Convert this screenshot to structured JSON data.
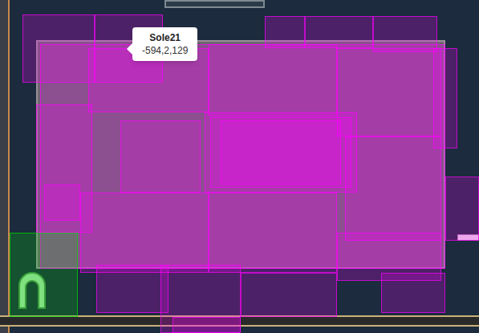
{
  "tooltip": {
    "title": "Sole21",
    "coords": "-594,2,129"
  },
  "regions": [
    {
      "color": "#ff00ff"
    },
    {
      "color": "#ff00ff"
    },
    {
      "color": "#ff00ff"
    },
    {
      "color": "#ff00ff"
    },
    {
      "color": "#ff00ff"
    },
    {
      "color": "#ff00ff"
    },
    {
      "color": "#ff00ff"
    },
    {
      "color": "#ff00ff"
    },
    {
      "color": "#ff00ff"
    },
    {
      "color": "#ff00ff"
    },
    {
      "color": "#ff00ff"
    },
    {
      "color": "#ff00ff"
    },
    {
      "color": "#ff00ff"
    },
    {
      "color": "#ff00ff"
    },
    {
      "color": "#ff00ff"
    },
    {
      "color": "#ff00ff"
    },
    {
      "color": "#ff00ff"
    },
    {
      "color": "#ff00ff"
    },
    {
      "color": "#ff00ff"
    },
    {
      "color": "#ff00ff"
    },
    {
      "color": "#ff00ff"
    },
    {
      "color": "#ff00ff"
    },
    {
      "color": "#ff00ff"
    },
    {
      "color": "#ff00ff"
    },
    {
      "color": "#ff00ff"
    },
    {
      "color": "#ff00ff"
    },
    {
      "color": "#00e000"
    }
  ]
}
